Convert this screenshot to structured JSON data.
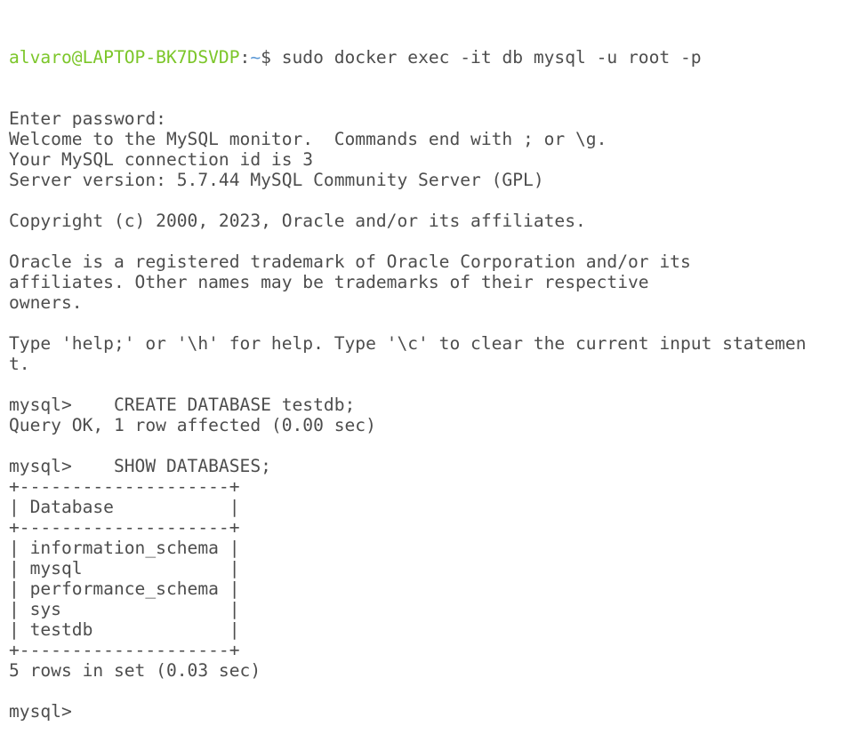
{
  "prompt": {
    "user_host": "alvaro@LAPTOP-BK7DSVDP",
    "separator": ":",
    "path": "~",
    "symbol": "$",
    "command": " sudo docker exec -it db mysql -u root -p"
  },
  "lines": [
    "Enter password:",
    "Welcome to the MySQL monitor.  Commands end with ; or \\g.",
    "Your MySQL connection id is 3",
    "Server version: 5.7.44 MySQL Community Server (GPL)",
    "",
    "Copyright (c) 2000, 2023, Oracle and/or its affiliates.",
    "",
    "Oracle is a registered trademark of Oracle Corporation and/or its",
    "affiliates. Other names may be trademarks of their respective",
    "owners.",
    "",
    "Type 'help;' or '\\h' for help. Type '\\c' to clear the current input statemen",
    "t.",
    "",
    "mysql>    CREATE DATABASE testdb;",
    "Query OK, 1 row affected (0.00 sec)",
    "",
    "mysql>    SHOW DATABASES;",
    "+--------------------+",
    "| Database           |",
    "+--------------------+",
    "| information_schema |",
    "| mysql              |",
    "| performance_schema |",
    "| sys                |",
    "| testdb             |",
    "+--------------------+",
    "5 rows in set (0.03 sec)",
    "",
    "mysql> "
  ],
  "colors": {
    "user_host": "#7cc62a",
    "path": "#5c99d6",
    "text": "#4d4d4d",
    "background": "#ffffff"
  }
}
